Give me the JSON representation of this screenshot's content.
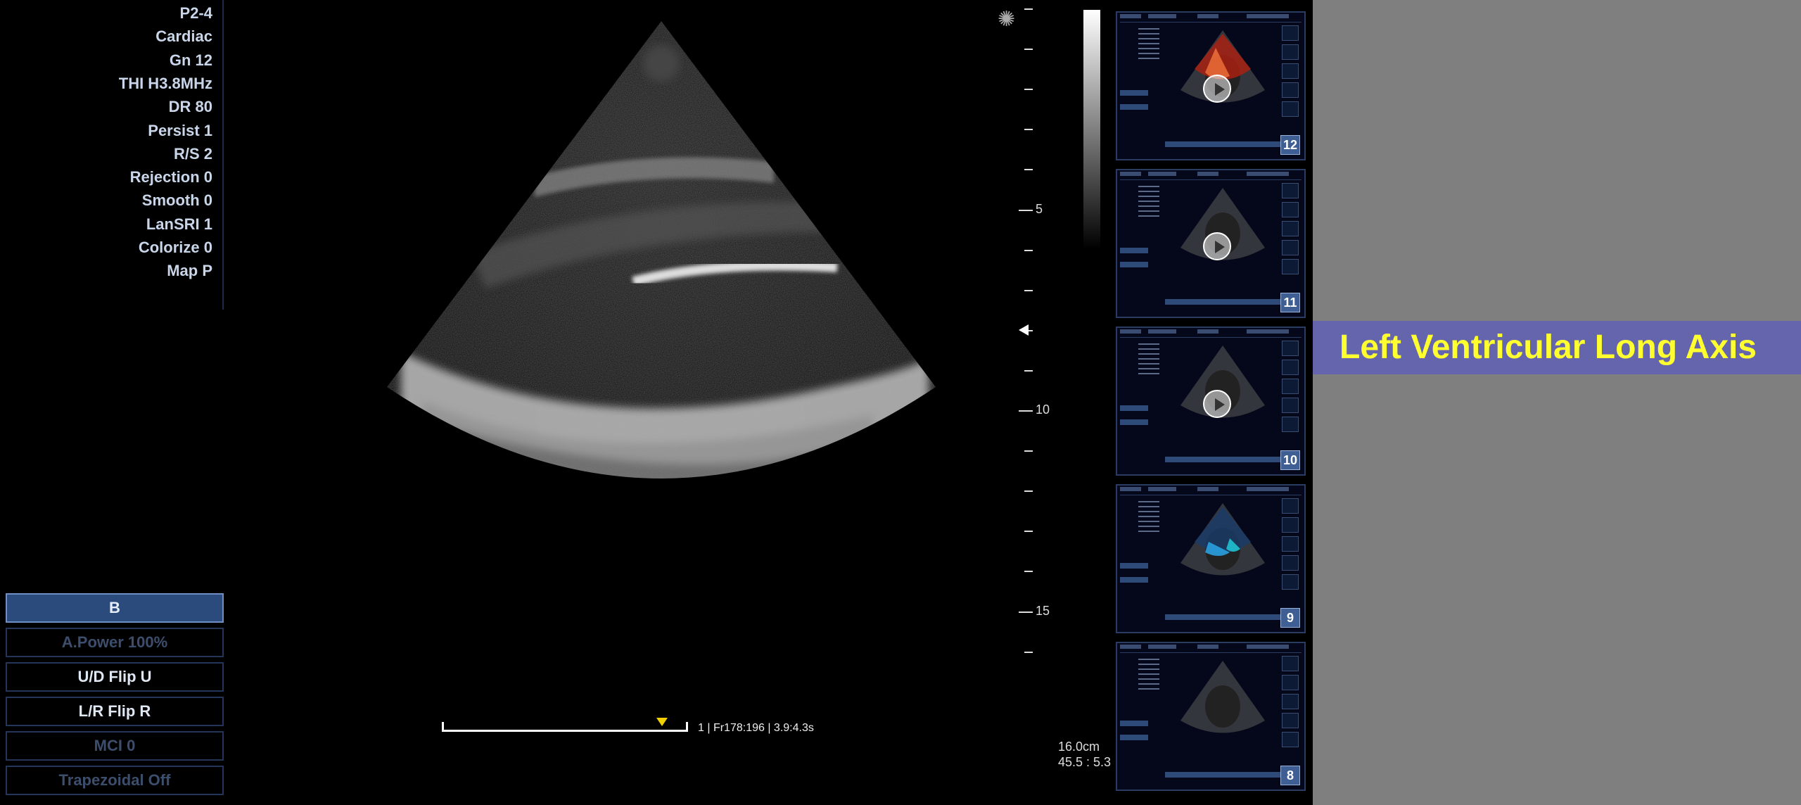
{
  "parameters": [
    "P2-4",
    "Cardiac",
    "Gn 12",
    "THI H3.8MHz",
    "DR 80",
    "Persist 1",
    "R/S 2",
    "Rejection 0",
    "Smooth 0",
    "LanSRI 1",
    "Colorize 0",
    "Map P"
  ],
  "mode_buttons": [
    {
      "label": "B",
      "state": "active"
    },
    {
      "label": "A.Power 100%",
      "state": "disabled"
    },
    {
      "label": "U/D Flip  U",
      "state": "normal"
    },
    {
      "label": "L/R Flip  R",
      "state": "normal"
    },
    {
      "label": "MCI 0",
      "state": "disabled"
    },
    {
      "label": "Trapezoidal  Off",
      "state": "disabled"
    }
  ],
  "depth_scale": {
    "labels": [
      "5",
      "10",
      "15"
    ],
    "max_cm": 16
  },
  "depth_info": {
    "depth": "16.0cm",
    "ratio": "45.5 : 5.3"
  },
  "cine": {
    "label": "1 | Fr178:196 | 3.9:4.3s",
    "position_fraction": 0.9
  },
  "thumbnails": [
    {
      "number": "12",
      "type": "color-doppler"
    },
    {
      "number": "11",
      "type": "b-mode"
    },
    {
      "number": "10",
      "type": "b-mode"
    },
    {
      "number": "9",
      "type": "color-doppler-blue"
    },
    {
      "number": "8",
      "type": "b-mode-still"
    }
  ],
  "title": "Left Ventricular Long Axis",
  "colors": {
    "banner_bg": "#6565ad",
    "banner_text": "#ffff30",
    "active_button": "#2c4b7d",
    "cine_marker": "#f0d000"
  }
}
